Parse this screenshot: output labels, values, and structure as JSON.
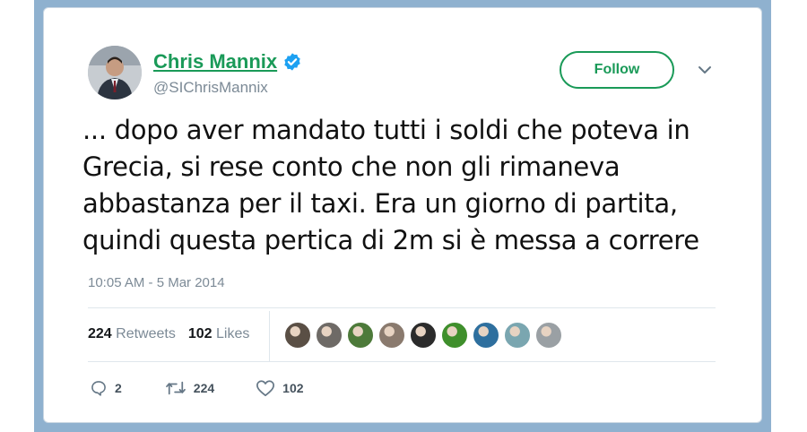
{
  "tweet": {
    "author_name": "Chris Mannix",
    "handle": "@SIChrisMannix",
    "follow_label": "Follow",
    "text_lines": [
      "... dopo aver mandato tutti i soldi che poteva in",
      "Grecia, si rese conto che non gli rimaneva",
      "abbastanza per il taxi. Era un giorno di partita,",
      "quindi questa pertica di 2m si è messa a correre"
    ],
    "timestamp": "10:05 AM - 5 Mar 2014",
    "stats": {
      "retweets_count": "224",
      "retweets_label": "Retweets",
      "likes_count": "102",
      "likes_label": "Likes"
    },
    "actions": {
      "replies": "2",
      "retweets": "224",
      "likes": "102"
    }
  },
  "colors": {
    "accent": "#1a9a58",
    "verified": "#1da1f2",
    "frame": "#8fb1cf",
    "muted": "#7c8a96"
  },
  "likers": [
    {
      "color": "#5a4f45"
    },
    {
      "color": "#6e6a66"
    },
    {
      "color": "#4d7a3a"
    },
    {
      "color": "#8a7a6e"
    },
    {
      "color": "#2b2b2b"
    },
    {
      "color": "#3f8f2c"
    },
    {
      "color": "#2e6f9e"
    },
    {
      "color": "#7aa6b0"
    },
    {
      "color": "#9aa0a4"
    }
  ]
}
